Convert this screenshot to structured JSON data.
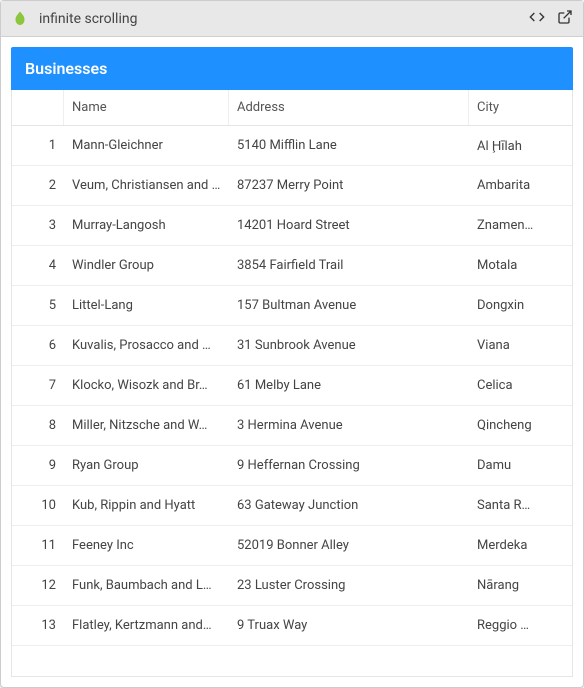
{
  "titlebar": {
    "title": "infinite scrolling"
  },
  "panel": {
    "header": "Businesses"
  },
  "columns": {
    "num": "",
    "name": "Name",
    "address": "Address",
    "city": "City"
  },
  "rows": [
    {
      "n": "1",
      "name": "Mann-Gleichner",
      "address": "5140 Mifflin Lane",
      "city": "Al Ḩīlah"
    },
    {
      "n": "2",
      "name": "Veum, Christiansen and …",
      "address": "87237 Merry Point",
      "city": "Ambarita"
    },
    {
      "n": "3",
      "name": "Murray-Langosh",
      "address": "14201 Hoard Street",
      "city": "Znamen…"
    },
    {
      "n": "4",
      "name": "Windler Group",
      "address": "3854 Fairfield Trail",
      "city": "Motala"
    },
    {
      "n": "5",
      "name": "Littel-Lang",
      "address": "157 Bultman Avenue",
      "city": "Dongxin"
    },
    {
      "n": "6",
      "name": "Kuvalis, Prosacco and …",
      "address": "31 Sunbrook Avenue",
      "city": "Viana"
    },
    {
      "n": "7",
      "name": "Klocko, Wisozk and Br…",
      "address": "61 Melby Lane",
      "city": "Celica"
    },
    {
      "n": "8",
      "name": "Miller, Nitzsche and W…",
      "address": "3 Hermina Avenue",
      "city": "Qincheng"
    },
    {
      "n": "9",
      "name": "Ryan Group",
      "address": "9 Heffernan Crossing",
      "city": "Damu"
    },
    {
      "n": "10",
      "name": "Kub, Rippin and Hyatt",
      "address": "63 Gateway Junction",
      "city": "Santa R…"
    },
    {
      "n": "11",
      "name": "Feeney Inc",
      "address": "52019 Bonner Alley",
      "city": "Merdeka"
    },
    {
      "n": "12",
      "name": "Funk, Baumbach and L…",
      "address": "23 Luster Crossing",
      "city": "Nārang"
    },
    {
      "n": "13",
      "name": "Flatley, Kertzmann and…",
      "address": "9 Truax Way",
      "city": "Reggio …"
    }
  ]
}
